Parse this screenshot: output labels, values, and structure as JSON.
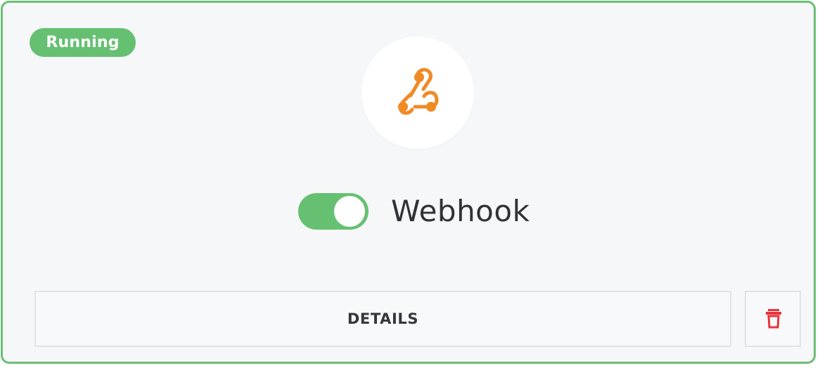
{
  "card": {
    "status": "Running",
    "integration_name": "Webhook",
    "toggle_enabled": true,
    "icon": "webhook-icon",
    "details_label": "DETAILS",
    "delete_icon": "trash-icon"
  },
  "colors": {
    "accent_green": "#66c071",
    "webhook_orange": "#f08a24",
    "delete_red": "#e8333b",
    "card_background": "#f6f7f8"
  }
}
